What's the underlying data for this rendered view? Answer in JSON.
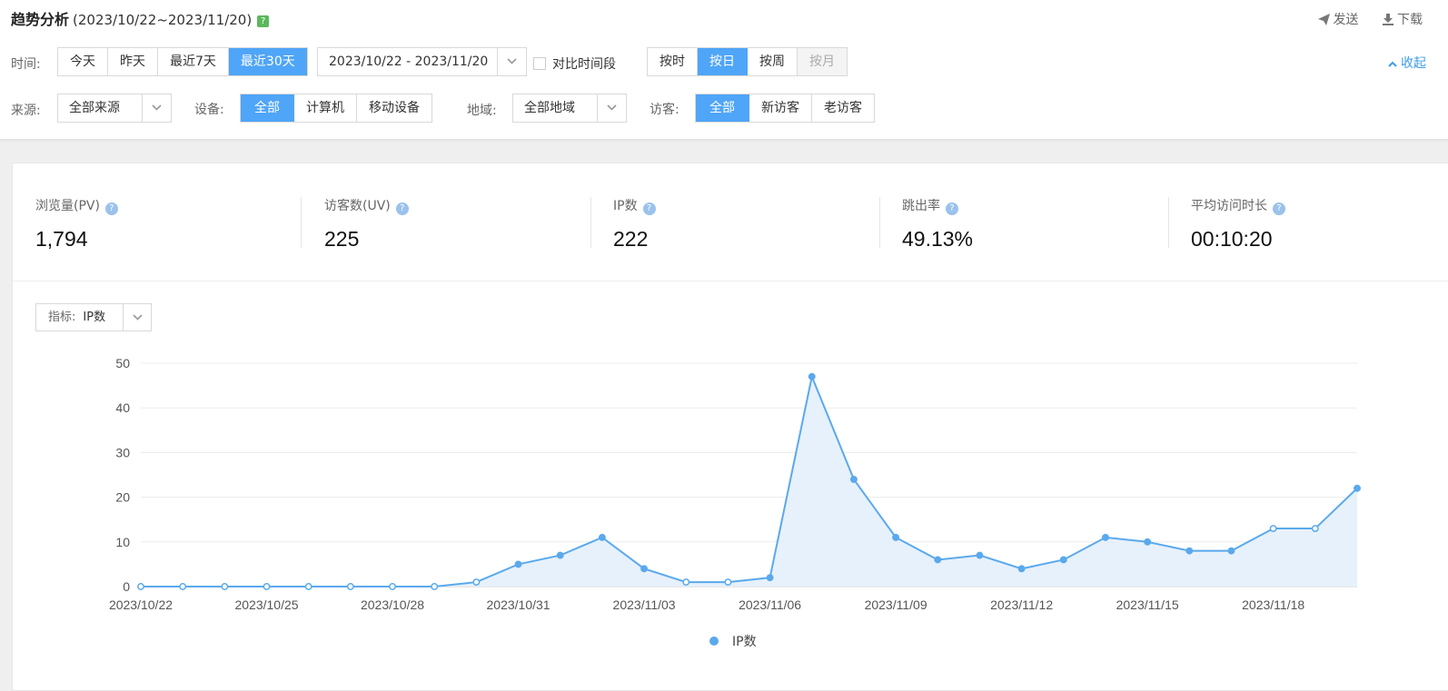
{
  "header": {
    "title": "趋势分析",
    "date_range": "(2023/10/22~2023/11/20)",
    "help": "?",
    "send_label": "发送",
    "download_label": "下载",
    "collapse_label": "收起"
  },
  "filters": {
    "time_label": "时间:",
    "time_options": [
      "今天",
      "昨天",
      "最近7天",
      "最近30天"
    ],
    "time_active": 3,
    "date_value": "2023/10/22 - 2023/11/20",
    "compare_label": "对比时间段",
    "granularity_options": [
      "按时",
      "按日",
      "按周",
      "按月"
    ],
    "granularity_active": 1,
    "granularity_disabled": 3,
    "source_label": "来源:",
    "source_value": "全部来源",
    "device_label": "设备:",
    "device_options": [
      "全部",
      "计算机",
      "移动设备"
    ],
    "device_active": 0,
    "region_label": "地域:",
    "region_value": "全部地域",
    "visitor_label": "访客:",
    "visitor_options": [
      "全部",
      "新访客",
      "老访客"
    ],
    "visitor_active": 0
  },
  "metrics": [
    {
      "label": "浏览量(PV)",
      "value": "1,794"
    },
    {
      "label": "访客数(UV)",
      "value": "225"
    },
    {
      "label": "IP数",
      "value": "222"
    },
    {
      "label": "跳出率",
      "value": "49.13%"
    },
    {
      "label": "平均访问时长",
      "value": "00:10:20"
    }
  ],
  "indicator": {
    "label": "指标:",
    "value": "IP数"
  },
  "colors": {
    "accent": "#4fa5f7",
    "line": "#5aa9ec",
    "area": "#e4f0fb"
  },
  "chart_data": {
    "type": "area",
    "x": [
      "2023/10/22",
      "2023/10/23",
      "2023/10/24",
      "2023/10/25",
      "2023/10/26",
      "2023/10/27",
      "2023/10/28",
      "2023/10/29",
      "2023/10/30",
      "2023/10/31",
      "2023/11/01",
      "2023/11/02",
      "2023/11/03",
      "2023/11/04",
      "2023/11/05",
      "2023/11/06",
      "2023/11/07",
      "2023/11/08",
      "2023/11/09",
      "2023/11/10",
      "2023/11/11",
      "2023/11/12",
      "2023/11/13",
      "2023/11/14",
      "2023/11/15",
      "2023/11/16",
      "2023/11/17",
      "2023/11/18",
      "2023/11/19",
      "2023/11/20"
    ],
    "x_tick_labels": [
      "2023/10/22",
      "2023/10/25",
      "2023/10/28",
      "2023/10/31",
      "2023/11/03",
      "2023/11/06",
      "2023/11/09",
      "2023/11/12",
      "2023/11/15",
      "2023/11/18"
    ],
    "series": [
      {
        "name": "IP数",
        "values": [
          0,
          0,
          0,
          0,
          0,
          0,
          0,
          0,
          1,
          5,
          7,
          11,
          4,
          1,
          1,
          2,
          47,
          24,
          11,
          6,
          7,
          4,
          6,
          11,
          10,
          8,
          8,
          13,
          13,
          22
        ]
      }
    ],
    "yticks": [
      0,
      10,
      20,
      30,
      40,
      50
    ],
    "ylim": [
      0,
      50
    ],
    "grid": true,
    "legend": "bottom-center"
  }
}
